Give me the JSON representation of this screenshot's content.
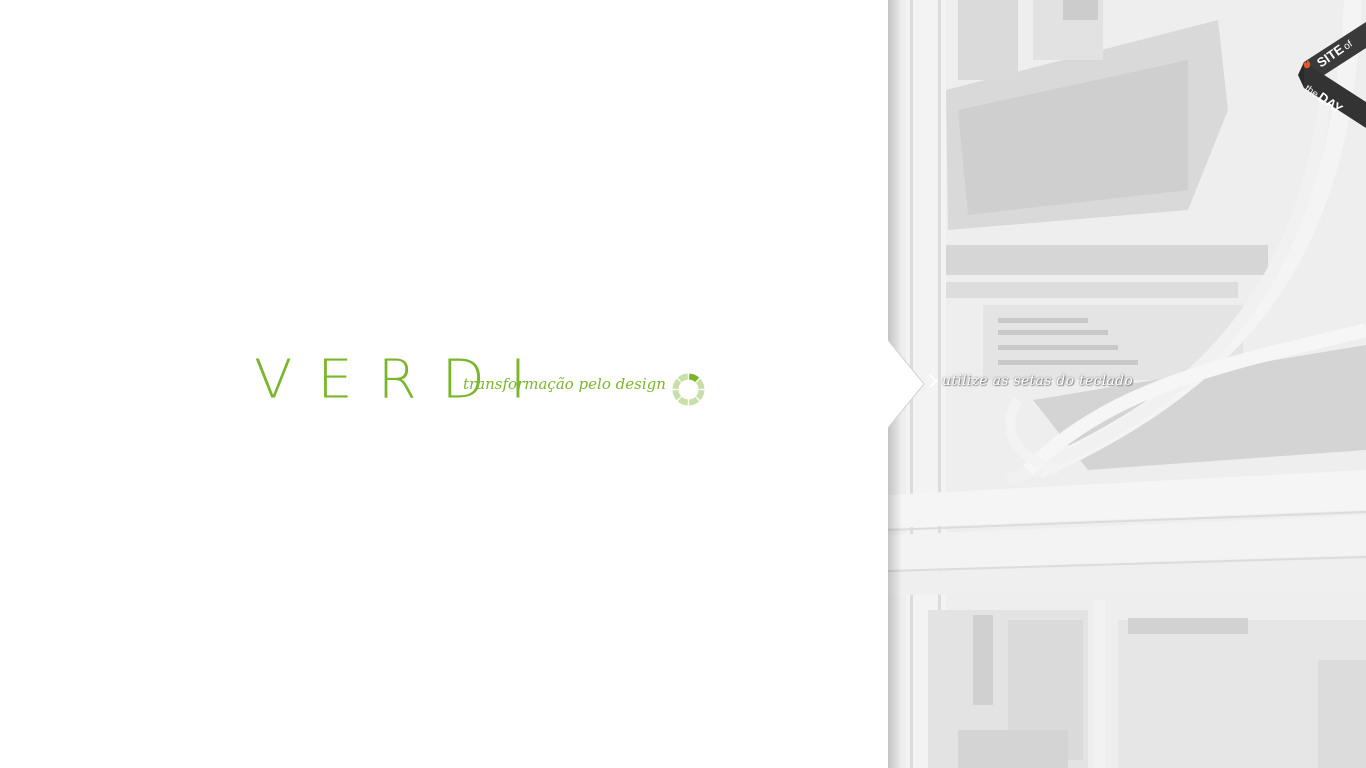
{
  "brand": {
    "logo_text": "VERDI",
    "tagline": "transformação pelo design",
    "accent_color": "#7ab62b",
    "loader_light_color": "#c8dfa8"
  },
  "navigation": {
    "hint_text": "utilize as setas do teclado",
    "arrow_icon": "chevron-right-icon"
  },
  "badge": {
    "line1_bold": "SITE",
    "line1_small": "of",
    "line2_small": "the",
    "line2_bold": "DAY",
    "ribbon_color": "#3a3a3a",
    "flame_color": "#e8542a"
  },
  "photo": {
    "subject": "aerial-highway-interchange"
  }
}
